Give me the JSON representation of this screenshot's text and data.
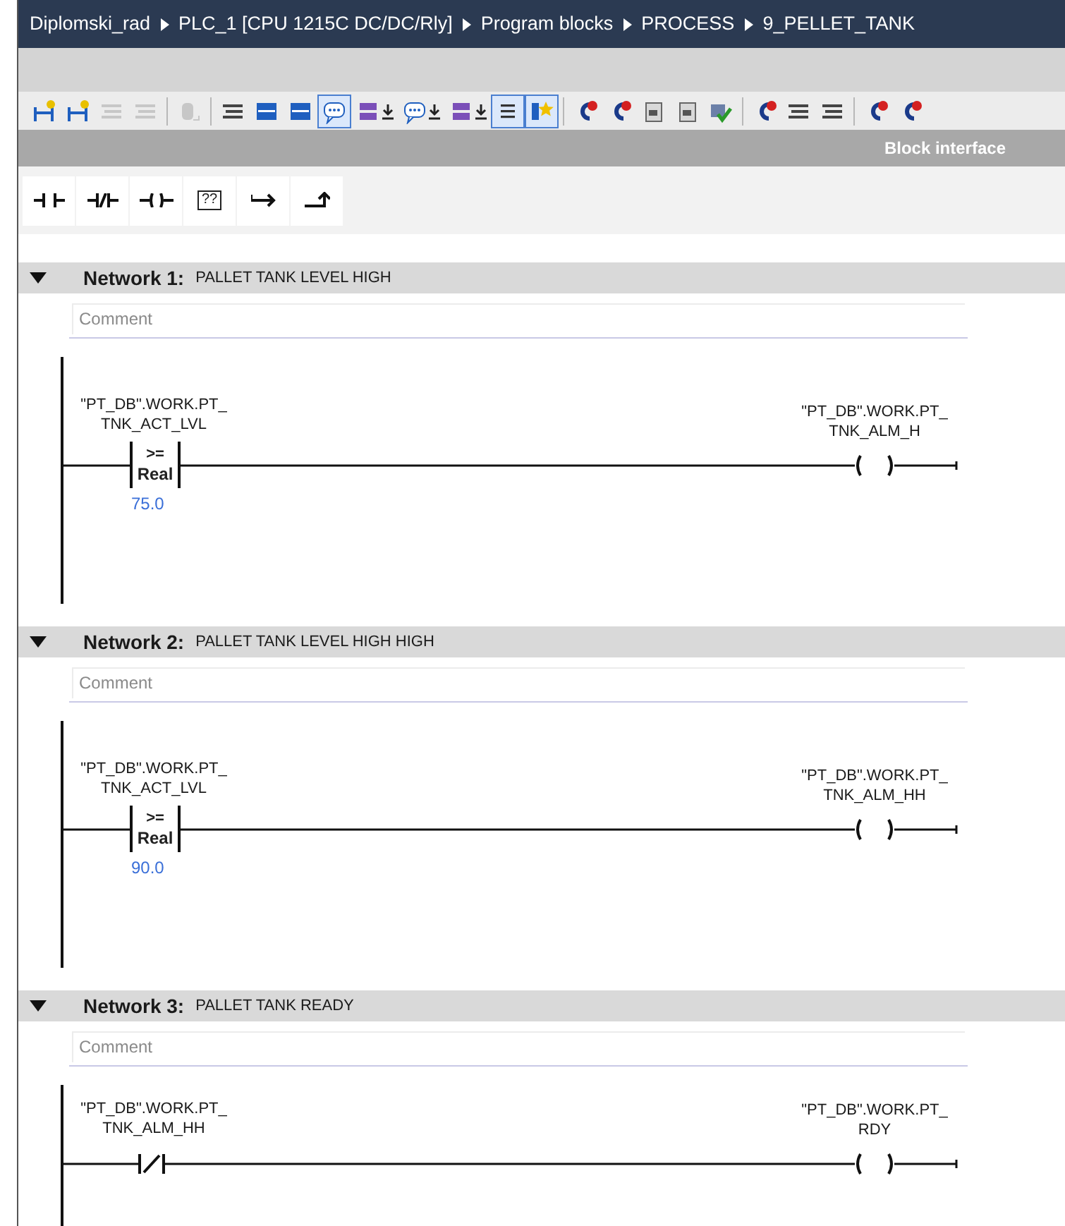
{
  "breadcrumb": [
    "Diplomski_rad",
    "PLC_1 [CPU 1215C DC/DC/Rly]",
    "Program blocks",
    "PROCESS",
    "9_PELLET_TANK"
  ],
  "toolbar": [
    {
      "selected": false,
      "disabled": false
    },
    {
      "selected": false,
      "disabled": false
    },
    {
      "selected": false,
      "disabled": true
    },
    {
      "selected": false,
      "disabled": true
    },
    {
      "selected": false,
      "disabled": true
    },
    {
      "selected": false,
      "disabled": false
    },
    {
      "selected": false,
      "disabled": false
    },
    {
      "selected": false,
      "disabled": false
    },
    {
      "selected": true,
      "disabled": false
    },
    {
      "selected": false,
      "disabled": false
    },
    {
      "selected": false,
      "disabled": false
    },
    {
      "selected": false,
      "disabled": false
    },
    {
      "selected": true,
      "disabled": false
    },
    {
      "selected": true,
      "disabled": false
    },
    {
      "selected": false,
      "disabled": false
    },
    {
      "selected": false,
      "disabled": false
    },
    {
      "selected": false,
      "disabled": false
    },
    {
      "selected": false,
      "disabled": false
    },
    {
      "selected": false,
      "disabled": false
    },
    {
      "selected": false,
      "disabled": false
    },
    {
      "selected": false,
      "disabled": false
    },
    {
      "selected": false,
      "disabled": false
    },
    {
      "selected": false,
      "disabled": false
    },
    {
      "selected": false,
      "disabled": false
    }
  ],
  "block_interface": "Block interface",
  "instructions": [
    {
      "kind": "no_contact"
    },
    {
      "kind": "nc_contact"
    },
    {
      "kind": "coil"
    },
    {
      "kind": "empty_box",
      "label": "??"
    },
    {
      "kind": "open_branch"
    },
    {
      "kind": "close_branch"
    }
  ],
  "networks": [
    {
      "number": "Network 1:",
      "title": "PALLET TANK LEVEL HIGH",
      "expanded": true,
      "comment": {
        "placeholder": "Comment"
      },
      "contact": {
        "kind": "compare",
        "operand": [
          "\"PT_DB\".WORK.PT_",
          "TNK_ACT_LVL"
        ],
        "operator": ">=",
        "type": "Real",
        "value": "75.0"
      },
      "coil": {
        "operand": [
          "\"PT_DB\".WORK.PT_",
          "TNK_ALM_H"
        ]
      }
    },
    {
      "number": "Network 2:",
      "title": "PALLET TANK LEVEL HIGH HIGH",
      "expanded": true,
      "comment": {
        "placeholder": "Comment"
      },
      "contact": {
        "kind": "compare",
        "operand": [
          "\"PT_DB\".WORK.PT_",
          "TNK_ACT_LVL"
        ],
        "operator": ">=",
        "type": "Real",
        "value": "90.0"
      },
      "coil": {
        "operand": [
          "\"PT_DB\".WORK.PT_",
          "TNK_ALM_HH"
        ]
      }
    },
    {
      "number": "Network 3:",
      "title": "PALLET TANK READY",
      "expanded": true,
      "comment": {
        "placeholder": "Comment"
      },
      "contact": {
        "kind": "nc_contact",
        "operand": [
          "\"PT_DB\".WORK.PT_",
          "TNK_ALM_HH"
        ]
      },
      "coil": {
        "operand": [
          "\"PT_DB\".WORK.PT_",
          "RDY"
        ]
      }
    }
  ]
}
